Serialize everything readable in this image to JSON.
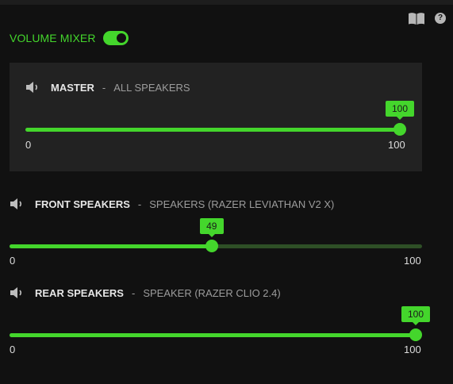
{
  "header": {
    "title": "VOLUME MIXER",
    "toggle_on": true,
    "book_icon": "book-icon",
    "help_icon": "help-icon",
    "help_glyph": "?"
  },
  "colors": {
    "accent": "#44d62c",
    "panel": "#222222",
    "background": "#111111"
  },
  "channels": [
    {
      "name": "MASTER",
      "separator": "-",
      "device": "ALL SPEAKERS",
      "value": "100",
      "min": "0",
      "max": "100",
      "fraction": 1.0,
      "icon": "speaker-icon"
    },
    {
      "name": "FRONT SPEAKERS",
      "separator": "-",
      "device": "SPEAKERS (RAZER LEVIATHAN V2 X)",
      "value": "49",
      "min": "0",
      "max": "100",
      "fraction": 0.49,
      "icon": "speaker-icon"
    },
    {
      "name": "REAR SPEAKERS",
      "separator": "-",
      "device": "SPEAKER (RAZER CLIO 2.4)",
      "value": "100",
      "min": "0",
      "max": "100",
      "fraction": 1.0,
      "icon": "speaker-icon"
    }
  ]
}
